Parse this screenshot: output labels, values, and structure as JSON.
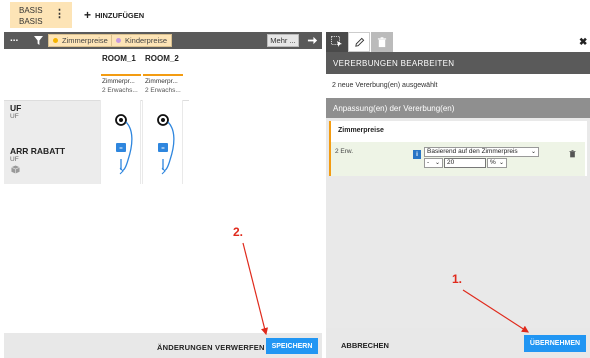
{
  "top": {
    "basis_label": "BASIS",
    "basis_sub": "BASIS",
    "add_label": "HINZUFÜGEN"
  },
  "toolbar": {
    "more": "...",
    "chips": [
      {
        "label": "Zimmerpreise",
        "dot_color": "#f5b400"
      },
      {
        "label": "Kinderpreise",
        "dot_color": "#c89be0"
      }
    ],
    "mehr_label": "Mehr ..."
  },
  "grid": {
    "columns": [
      {
        "title": "ROOM_1",
        "sub1": "Zimmerpr...",
        "sub2": "2 Erwachs..."
      },
      {
        "title": "ROOM_2",
        "sub1": "Zimmerpr...",
        "sub2": "2 Erwachs..."
      }
    ],
    "rows": [
      {
        "label": "UF",
        "sub": "UF"
      },
      {
        "label": "ARR RABATT",
        "sub": "UF"
      }
    ]
  },
  "left_footer": {
    "discard_label": "ÄNDERUNGEN VERWERFEN",
    "save_label": "SPEICHERN"
  },
  "right_panel": {
    "header": "VERERBUNGEN BEARBEITEN",
    "info": "2 neue Vererbung(en) ausgewählt",
    "adjust_header": "Anpassung(en) der Vererbung(en)",
    "card_title": "Zimmerpreise",
    "row_label": "2 Erw.",
    "basis_select": "Basierend auf den Zimmerpreis",
    "op_select": "-",
    "value": "20",
    "unit_select": "%",
    "cancel_label": "ABBRECHEN",
    "apply_label": "ÜBERNEHMEN"
  },
  "annotations": {
    "step1": "1.",
    "step2": "2."
  },
  "colors": {
    "accent": "#2196f3",
    "orange": "#f39c12",
    "annotation": "#e02a1c"
  }
}
